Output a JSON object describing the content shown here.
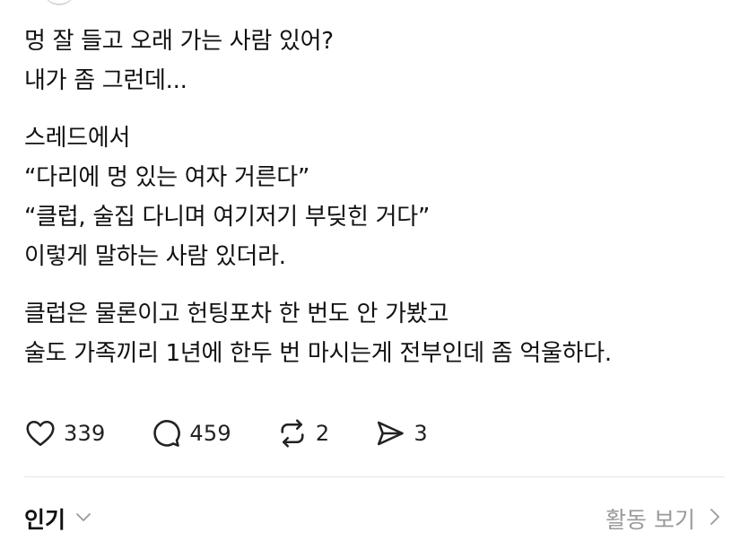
{
  "post": {
    "paragraphs": [
      [
        "멍 잘 들고 오래 가는 사람 있어?",
        "내가 좀 그런데..."
      ],
      [
        "스레드에서",
        "“다리에 멍 있는 여자 거른다”",
        "“클럽, 술집 다니며 여기저기 부딪힌 거다”",
        "이렇게 말하는 사람 있더라."
      ],
      [
        "클럽은 물론이고 헌팅포차 한 번도 안 가봤고",
        "술도 가족끼리 1년에 한두 번 마시는게 전부인데 좀 억울하다."
      ]
    ]
  },
  "actions": {
    "like": {
      "icon": "heart-icon",
      "count": "339"
    },
    "reply": {
      "icon": "speech-bubble-icon",
      "count": "459"
    },
    "repost": {
      "icon": "repost-icon",
      "count": "2"
    },
    "share": {
      "icon": "send-icon",
      "count": "3"
    }
  },
  "footer": {
    "sort_label": "인기",
    "sort_icon": "chevron-down-icon",
    "activity_label": "활동 보기",
    "activity_icon": "chevron-right-icon"
  }
}
